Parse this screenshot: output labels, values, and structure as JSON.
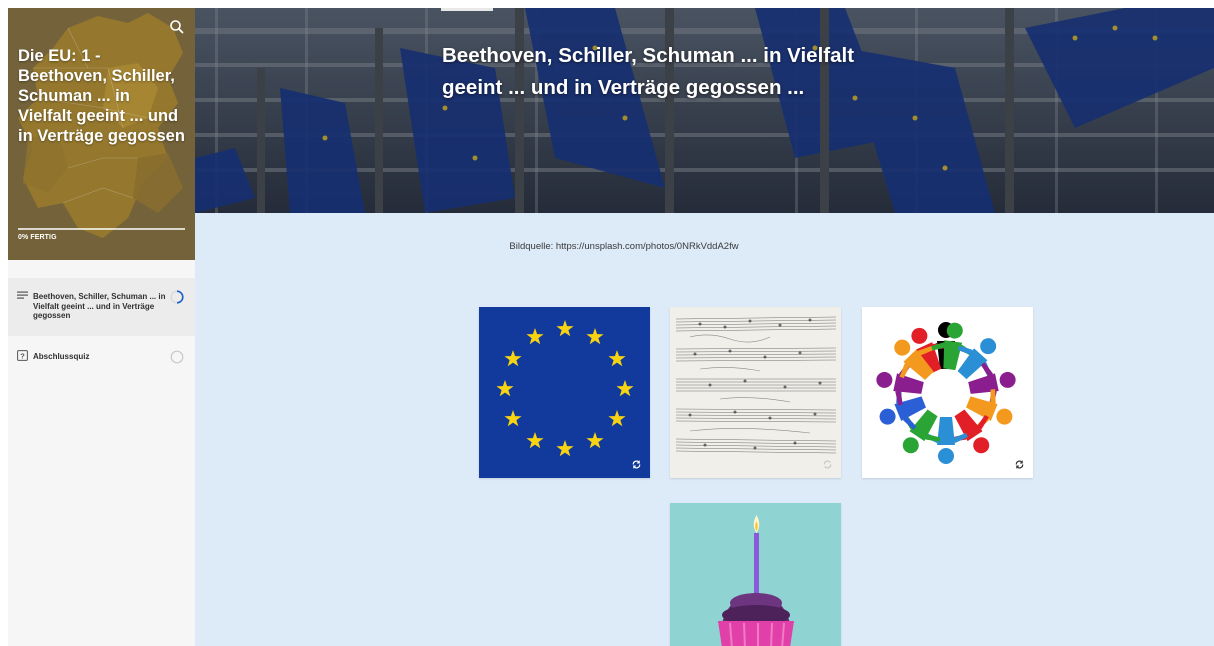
{
  "sidebar": {
    "course_title": "Die EU: 1 - Beethoven, Schiller, Schuman ... in Vielfalt geeint ... und in Verträge gegossen",
    "progress_label": "0% FERTIG",
    "progress_percent": 0,
    "items": [
      {
        "label": "Beethoven, Schiller, Schuman ... in Vielfalt geeint ... und in Verträge gegossen",
        "icon": "lines-icon",
        "status": "in-progress",
        "active": true
      },
      {
        "label": "Abschlussquiz",
        "icon": "quiz-icon",
        "status": "not-started",
        "active": false
      }
    ]
  },
  "hero": {
    "title": "Beethoven, Schiller, Schuman ... in Vielfalt geeint ... und in Verträge gegossen ..."
  },
  "content": {
    "caption": "Bildquelle: https://unsplash.com/photos/0NRkVddA2fw",
    "cards": [
      {
        "name": "eu-flag",
        "icon": "flip-icon"
      },
      {
        "name": "music-score",
        "icon": "flip-icon"
      },
      {
        "name": "people-circle",
        "icon": "flip-icon"
      },
      {
        "name": "cupcake"
      }
    ]
  },
  "colors": {
    "accent": "#1c62c8",
    "eu_blue": "#113a9c",
    "eu_star": "#f7d311",
    "content_bg": "#ddeaf8",
    "sidebar_header": "#7b6a3a"
  }
}
